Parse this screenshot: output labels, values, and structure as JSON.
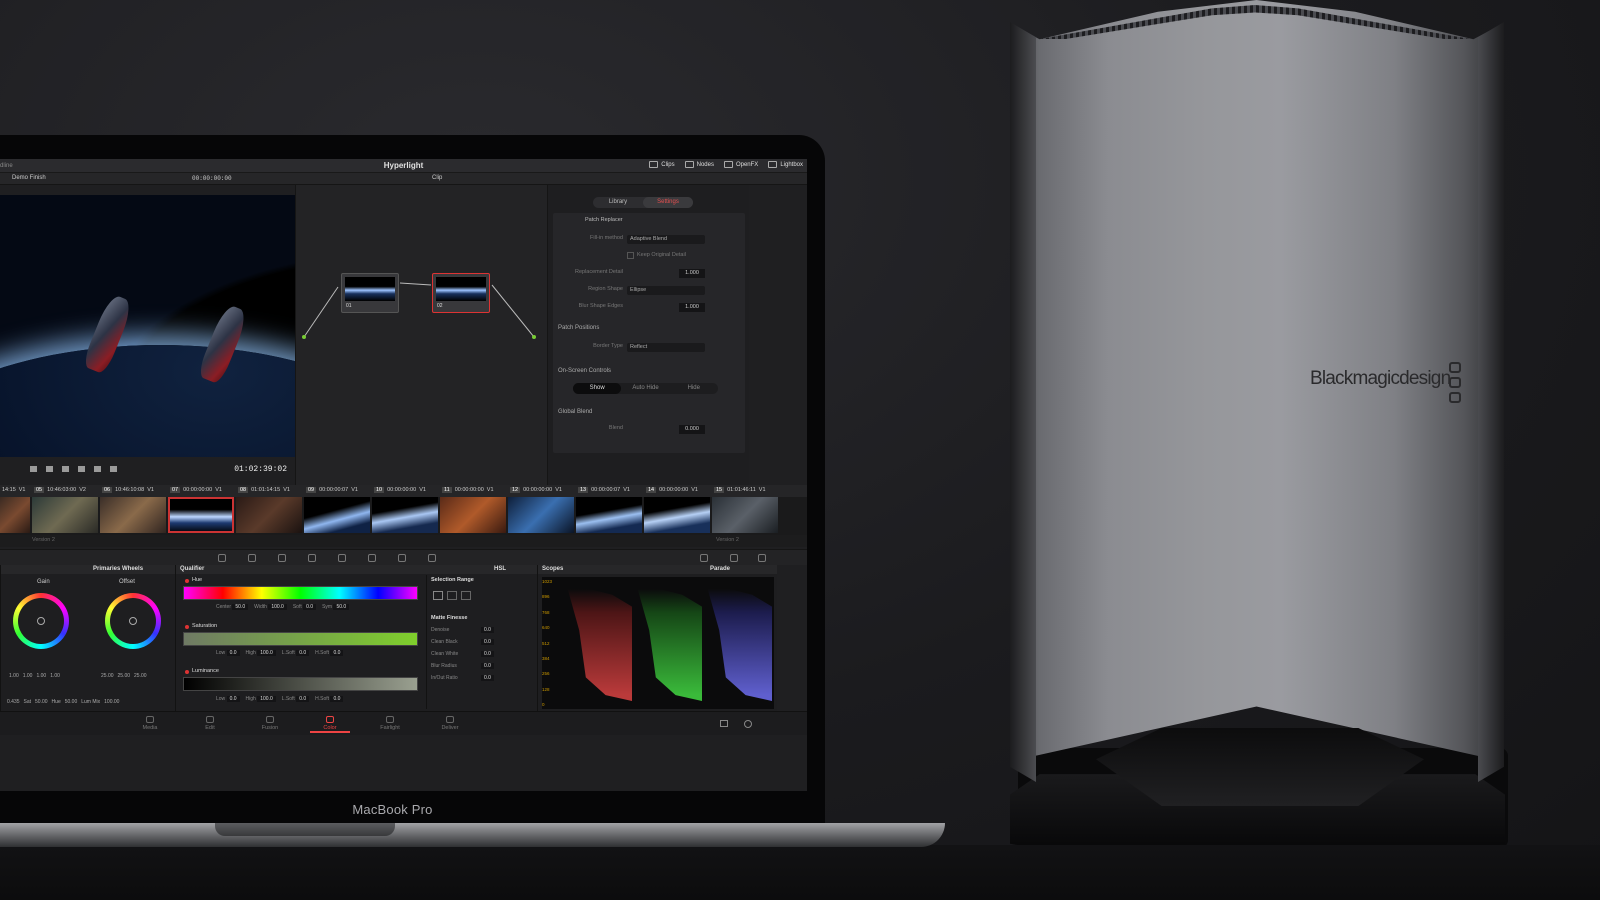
{
  "app": {
    "window_title": "Hyperlight",
    "left_title_fragment": "dline",
    "project_menu": "Demo Finish",
    "timecode_top": "00:00:00:00",
    "clip_menu": "Clip",
    "toolbar_buttons": [
      "Clips",
      "Nodes",
      "OpenFX",
      "Lightbox"
    ]
  },
  "viewer": {
    "timecode": "01:02:39:02"
  },
  "inspector": {
    "tabs": [
      "Library",
      "Settings"
    ],
    "active_tab": "Settings",
    "effect_name": "Patch Replacer",
    "fill_in_method_label": "Fill-in method",
    "fill_in_method_value": "Adaptive Blend",
    "keep_original_detail": "Keep Original Detail",
    "replacement_detail_label": "Replacement Detail",
    "replacement_detail_value": "1.000",
    "region_shape_label": "Region Shape",
    "region_shape_value": "Ellipse",
    "blur_shape_edges_label": "Blur Shape Edges",
    "blur_shape_edges_value": "1.000",
    "patch_positions": "Patch Positions",
    "border_type_label": "Border Type",
    "border_type_value": "Reflect",
    "on_screen_controls": "On-Screen Controls",
    "osc_options": [
      "Show",
      "Auto Hide",
      "Hide"
    ],
    "global_blend": "Global Blend",
    "blend_label": "Blend",
    "blend_value": "0.000"
  },
  "clip_strip": {
    "headers": [
      {
        "num": "",
        "tc": "14:15",
        "track": "V1"
      },
      {
        "num": "05",
        "tc": "10:46:03:00",
        "track": "V2"
      },
      {
        "num": "06",
        "tc": "10:46:10:08",
        "track": "V1"
      },
      {
        "num": "07",
        "tc": "00:00:00:00",
        "track": "V1"
      },
      {
        "num": "08",
        "tc": "01:01:14:15",
        "track": "V1"
      },
      {
        "num": "09",
        "tc": "00:00:00:07",
        "track": "V1"
      },
      {
        "num": "10",
        "tc": "00:00:00:00",
        "track": "V1"
      },
      {
        "num": "11",
        "tc": "00:00:00:00",
        "track": "V1"
      },
      {
        "num": "12",
        "tc": "00:00:00:00",
        "track": "V1"
      },
      {
        "num": "13",
        "tc": "00:00:00:07",
        "track": "V1"
      },
      {
        "num": "14",
        "tc": "00:00:00:00",
        "track": "V1"
      },
      {
        "num": "15",
        "tc": "01:01:46:11",
        "track": "V1"
      }
    ],
    "footer_left": "Version 2",
    "footer_right": "Version 2"
  },
  "primaries": {
    "title": "Primaries Wheels",
    "gain_label": "Gain",
    "offset_label": "Offset",
    "gain_values": [
      "1.00",
      "1.00",
      "1.00",
      "1.00"
    ],
    "offset_values": [
      "25.00",
      "25.00",
      "25.00"
    ],
    "bottom_values": [
      {
        "label": "",
        "value": "0.435"
      },
      {
        "label": "Sat",
        "value": "50.00"
      },
      {
        "label": "Hue",
        "value": "50.00"
      },
      {
        "label": "Lum Mix",
        "value": "100.00"
      }
    ]
  },
  "qualifier": {
    "title": "Qualifier",
    "mode": "HSL",
    "hue_label": "Hue",
    "hue_values": [
      {
        "label": "Center",
        "value": "50.0"
      },
      {
        "label": "Width",
        "value": "100.0"
      },
      {
        "label": "Soft",
        "value": "0.0"
      },
      {
        "label": "Sym",
        "value": "50.0"
      }
    ],
    "saturation_label": "Saturation",
    "sat_values": [
      {
        "label": "Low",
        "value": "0.0"
      },
      {
        "label": "High",
        "value": "100.0"
      },
      {
        "label": "L.Soft",
        "value": "0.0"
      },
      {
        "label": "H.Soft",
        "value": "0.0"
      }
    ],
    "luminance_label": "Luminance",
    "lum_values": [
      {
        "label": "Low",
        "value": "0.0"
      },
      {
        "label": "High",
        "value": "100.0"
      },
      {
        "label": "L.Soft",
        "value": "0.0"
      },
      {
        "label": "H.Soft",
        "value": "0.0"
      }
    ],
    "selection_range": "Selection Range",
    "matte_finesse": "Matte Finesse",
    "matte_rows": [
      {
        "label": "Denoise",
        "value": "0.0"
      },
      {
        "label": "Clean Black",
        "value": "0.0"
      },
      {
        "label": "Clean White",
        "value": "0.0"
      },
      {
        "label": "Blur Radius",
        "value": "0.0"
      },
      {
        "label": "In/Out Ratio",
        "value": "0.0"
      }
    ]
  },
  "scopes": {
    "title": "Scopes",
    "mode": "Parade",
    "ticks": [
      "1023",
      "896",
      "768",
      "640",
      "512",
      "384",
      "256",
      "128",
      "0"
    ]
  },
  "pages": {
    "items": [
      "Media",
      "Edit",
      "Fusion",
      "Color",
      "Fairlight",
      "Deliver"
    ],
    "active": "Color"
  },
  "laptop_label": "MacBook Pro",
  "egpu_brand": "Blackmagicdesign",
  "colors": {
    "accent_red": "#e04848",
    "resolve_bg": "#1f1f21"
  }
}
